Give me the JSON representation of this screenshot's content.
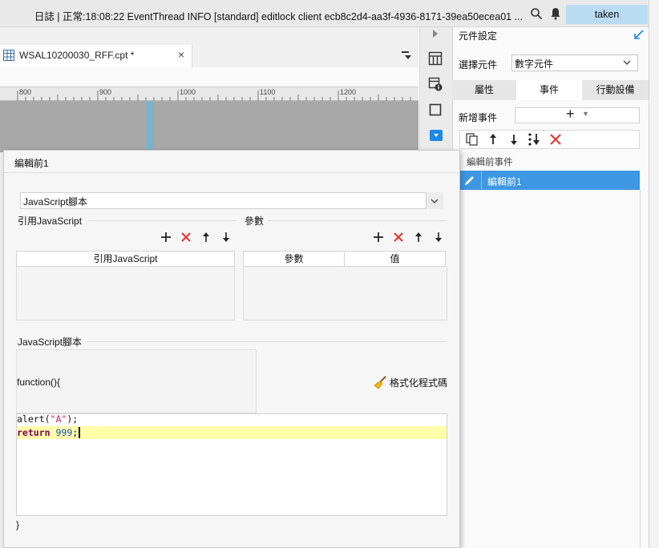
{
  "status_bar": {
    "text": "日誌 | 正常:18:08:22 EventThread INFO [standard] editlock client ecb8c2d4-aa3f-4936-8171-39ea50ecea01 ...",
    "user": "taken"
  },
  "editor": {
    "file_tab": {
      "name": "WSAL10200030_RFF.cpt *",
      "close": "×"
    },
    "ruler": [
      "800",
      "900",
      "1000",
      "1100",
      "1200"
    ]
  },
  "right_panel": {
    "title": "元件設定",
    "select_label": "選擇元件",
    "select_value": "數字元件",
    "tabs": [
      {
        "label": "屬性",
        "active": false
      },
      {
        "label": "事件",
        "active": true
      },
      {
        "label": "行動設備",
        "active": false
      }
    ],
    "add_event_label": "新增事件",
    "add_event_button": "+",
    "event_group": "編輯前事件",
    "events": [
      {
        "name": "編輯前1",
        "selected": true
      }
    ]
  },
  "dialog": {
    "title": "編輯前1",
    "type_value": "JavaScript腳本",
    "ref_section": "引用JavaScript",
    "ref_column": "引用JavaScript",
    "param_section": "參數",
    "param_columns": [
      "參數",
      "值"
    ],
    "script_section": "JavaScript腳本",
    "fn_open": "function(){",
    "format_label": "格式化程式碼",
    "code_line1": {
      "fn": "alert(",
      "str": "\"A\"",
      "end": ");"
    },
    "code_line2": {
      "kw": "return",
      "num": "999",
      "end": ";"
    },
    "fn_close": "}"
  },
  "colors": {
    "selection_blue": "#3d97e3",
    "user_badge": "#b9dcf3",
    "highlight_line": "#ffffaa",
    "delete_red": "#e53935"
  }
}
